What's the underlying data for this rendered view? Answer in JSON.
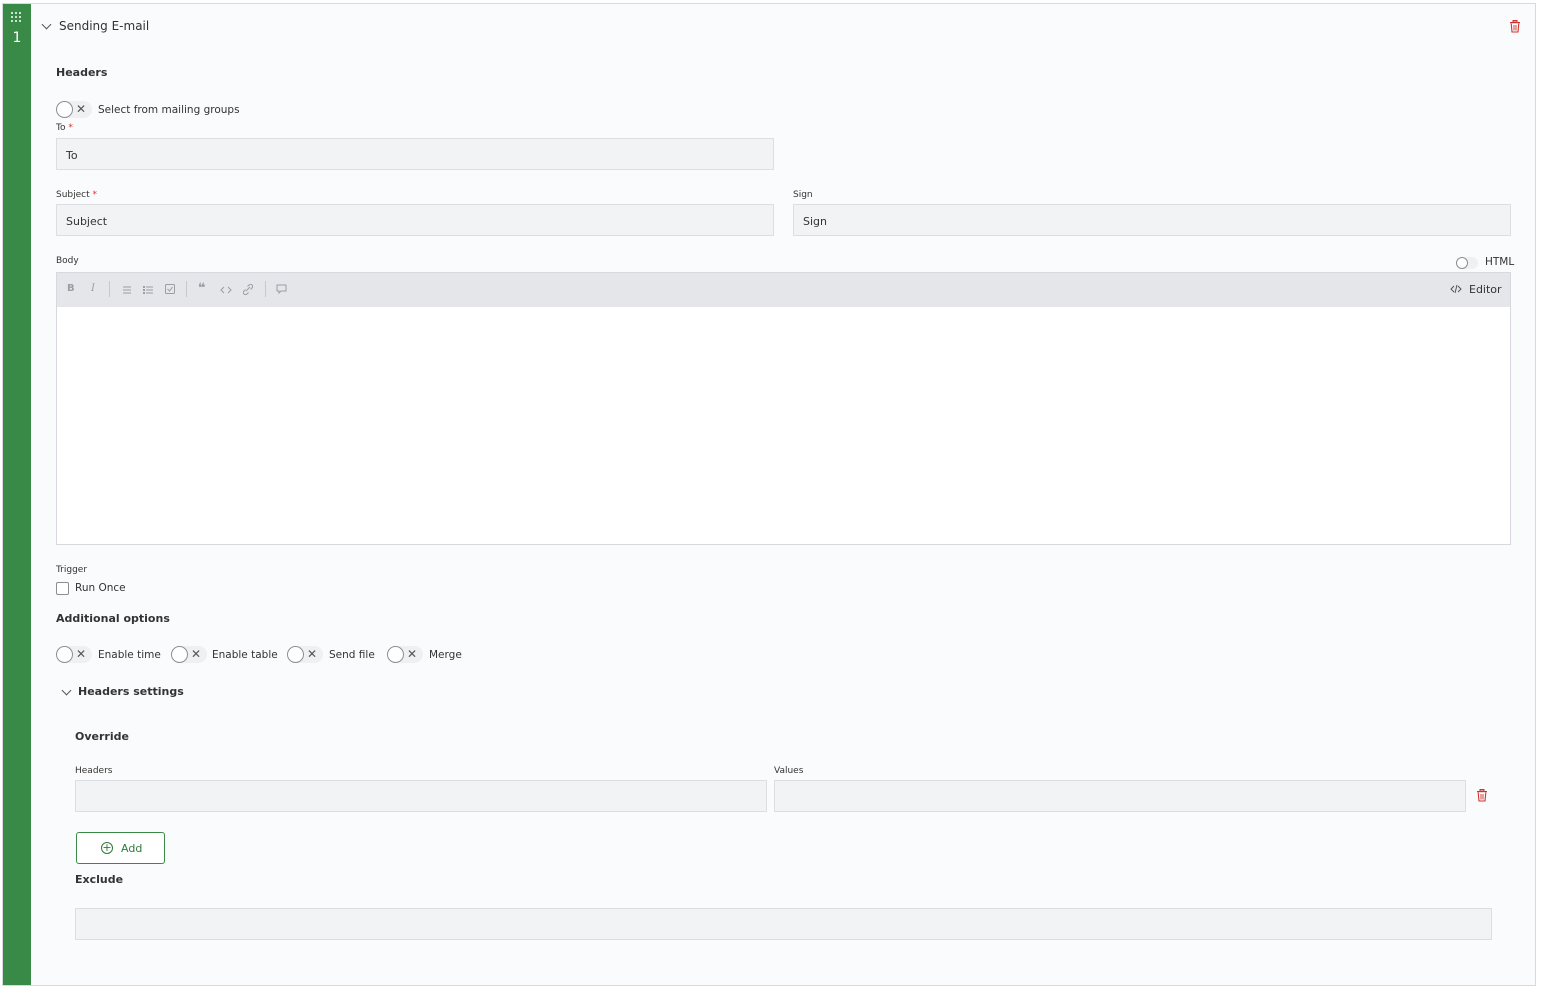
{
  "step": {
    "number": "1",
    "title": "Sending E-mail"
  },
  "headers": {
    "title": "Headers",
    "mailing_toggle_label": "Select from mailing groups",
    "to_label": "To",
    "to_required": "*",
    "to_placeholder": "To",
    "subject_label": "Subject",
    "subject_required": "*",
    "subject_placeholder": "Subject",
    "sign_label": "Sign",
    "sign_placeholder": "Sign"
  },
  "body": {
    "label": "Body",
    "html_toggle_label": "HTML",
    "editor_button": "Editor",
    "toolbar": {
      "bold": "B",
      "italic": "I"
    }
  },
  "trigger": {
    "label": "Trigger",
    "run_once": "Run Once"
  },
  "additional": {
    "title": "Additional options",
    "enable_time": "Enable time",
    "enable_table": "Enable table",
    "send_file": "Send file",
    "merge": "Merge"
  },
  "headers_settings": {
    "title": "Headers settings",
    "override_title": "Override",
    "headers_col": "Headers",
    "values_col": "Values",
    "add_button": "Add",
    "exclude_title": "Exclude"
  },
  "colors": {
    "accent": "#3a8a47",
    "danger": "#d2322d"
  },
  "icons": {
    "drag": "drag-grid-icon",
    "delete": "trash-icon",
    "collapse": "chevron-down-icon",
    "add": "plus-circle-icon",
    "code": "code-icon"
  }
}
